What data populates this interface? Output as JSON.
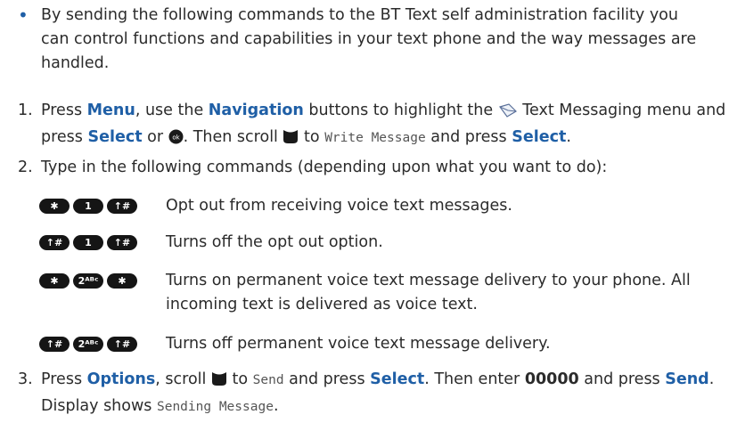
{
  "intro": {
    "bullet": "•",
    "text": "By sending the following commands to the BT Text self administration facility you can control functions and capabilities in your text phone and the way messages are handled."
  },
  "step1": {
    "num": "1.",
    "t1": "Press ",
    "menu": "Menu",
    "t2": ", use the ",
    "navigation": "Navigation",
    "t3": " buttons to highlight the ",
    "t4": " Text Messaging menu and press ",
    "select": "Select",
    "t5": " or ",
    "t6": ". Then scroll ",
    "t7": " to ",
    "lcd": "Write Message",
    "t8": " and press ",
    "select2": "Select",
    "t9": "."
  },
  "step2": {
    "num": "2.",
    "text": "Type in the following commands (depending upon what you want to do):"
  },
  "commands": [
    {
      "keys": [
        "✱",
        "1",
        "↑#"
      ],
      "desc": "Opt out from receiving voice text messages."
    },
    {
      "keys": [
        "↑#",
        "1",
        "↑#"
      ],
      "desc": "Turns off the opt out option."
    },
    {
      "keys": [
        "✱",
        "2ᴬᴮᶜ",
        "✱"
      ],
      "desc": "Turns on permanent voice text message delivery to your phone. All incoming text is delivered as voice text."
    },
    {
      "keys": [
        "↑#",
        "2ᴬᴮᶜ",
        "↑#"
      ],
      "desc": "Turns off permanent voice text message delivery."
    }
  ],
  "step3": {
    "num": "3.",
    "t1": "Press ",
    "options": "Options",
    "t2": ", scroll ",
    "t3": " to ",
    "lcd_send": "Send",
    "t4": " and press ",
    "select": "Select",
    "t5": ". Then enter ",
    "code": "00000",
    "t6": " and press ",
    "send": "Send",
    "t7": ". Display shows ",
    "lcd_sending": "Sending Message",
    "t8": "."
  },
  "icons": {
    "messaging": "text-messaging-envelope-icon",
    "ok": "ok-button-icon",
    "scroll": "scroll-key-icon"
  },
  "colors": {
    "accent": "#1f5fa6",
    "text": "#2b2b2b",
    "key": "#151515"
  }
}
